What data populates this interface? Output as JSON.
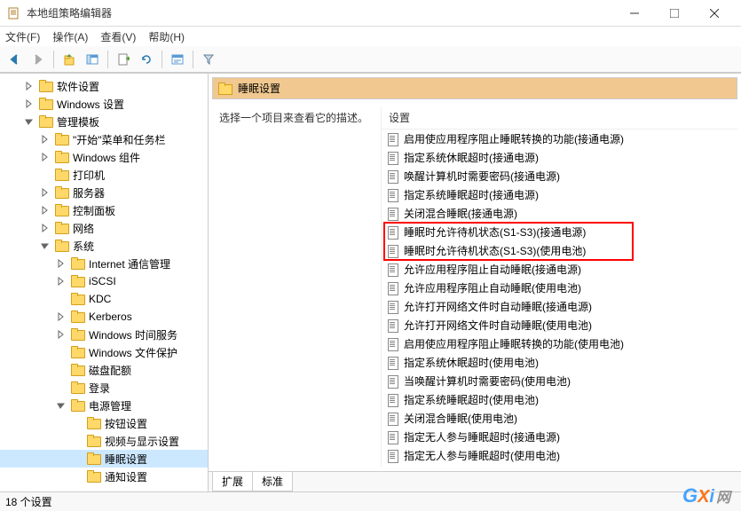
{
  "window": {
    "title": "本地组策略编辑器"
  },
  "menu": {
    "file": "文件(F)",
    "action": "操作(A)",
    "view": "查看(V)",
    "help": "帮助(H)"
  },
  "tree": {
    "items": [
      {
        "label": "软件设置",
        "indent": 1,
        "toggle": ">"
      },
      {
        "label": "Windows 设置",
        "indent": 1,
        "toggle": ">"
      },
      {
        "label": "管理模板",
        "indent": 1,
        "toggle": "v"
      },
      {
        "label": "\"开始\"菜单和任务栏",
        "indent": 2,
        "toggle": ">"
      },
      {
        "label": "Windows 组件",
        "indent": 2,
        "toggle": ">"
      },
      {
        "label": "打印机",
        "indent": 2,
        "toggle": ""
      },
      {
        "label": "服务器",
        "indent": 2,
        "toggle": ">"
      },
      {
        "label": "控制面板",
        "indent": 2,
        "toggle": ">"
      },
      {
        "label": "网络",
        "indent": 2,
        "toggle": ">"
      },
      {
        "label": "系统",
        "indent": 2,
        "toggle": "v"
      },
      {
        "label": "Internet 通信管理",
        "indent": 3,
        "toggle": ">"
      },
      {
        "label": "iSCSI",
        "indent": 3,
        "toggle": ">"
      },
      {
        "label": "KDC",
        "indent": 3,
        "toggle": ""
      },
      {
        "label": "Kerberos",
        "indent": 3,
        "toggle": ">"
      },
      {
        "label": "Windows 时间服务",
        "indent": 3,
        "toggle": ">"
      },
      {
        "label": "Windows 文件保护",
        "indent": 3,
        "toggle": ""
      },
      {
        "label": "磁盘配额",
        "indent": 3,
        "toggle": ""
      },
      {
        "label": "登录",
        "indent": 3,
        "toggle": ""
      },
      {
        "label": "电源管理",
        "indent": 3,
        "toggle": "v"
      },
      {
        "label": "按钮设置",
        "indent": 4,
        "toggle": ""
      },
      {
        "label": "视频与显示设置",
        "indent": 4,
        "toggle": ""
      },
      {
        "label": "睡眠设置",
        "indent": 4,
        "toggle": "",
        "selected": true
      },
      {
        "label": "通知设置",
        "indent": 4,
        "toggle": ""
      }
    ]
  },
  "header": {
    "title": "睡眠设置"
  },
  "description": "选择一个项目来查看它的描述。",
  "column_header": "设置",
  "settings": [
    "启用使应用程序阻止睡眠转换的功能(接通电源)",
    "指定系统休眠超时(接通电源)",
    "唤醒计算机时需要密码(接通电源)",
    "指定系统睡眠超时(接通电源)",
    "关闭混合睡眠(接通电源)",
    "睡眠时允许待机状态(S1-S3)(接通电源)",
    "睡眠时允许待机状态(S1-S3)(使用电池)",
    "允许应用程序阻止自动睡眠(接通电源)",
    "允许应用程序阻止自动睡眠(使用电池)",
    "允许打开网络文件时自动睡眠(接通电源)",
    "允许打开网络文件时自动睡眠(使用电池)",
    "启用使应用程序阻止睡眠转换的功能(使用电池)",
    "指定系统休眠超时(使用电池)",
    "当唤醒计算机时需要密码(使用电池)",
    "指定系统睡眠超时(使用电池)",
    "关闭混合睡眠(使用电池)",
    "指定无人参与睡眠超时(接通电源)",
    "指定无人参与睡眠超时(使用电池)"
  ],
  "tabs": {
    "extended": "扩展",
    "standard": "标准"
  },
  "status": "18 个设置",
  "watermark": {
    "g": "G",
    "x": "X",
    "i": "i",
    "net": "网"
  }
}
